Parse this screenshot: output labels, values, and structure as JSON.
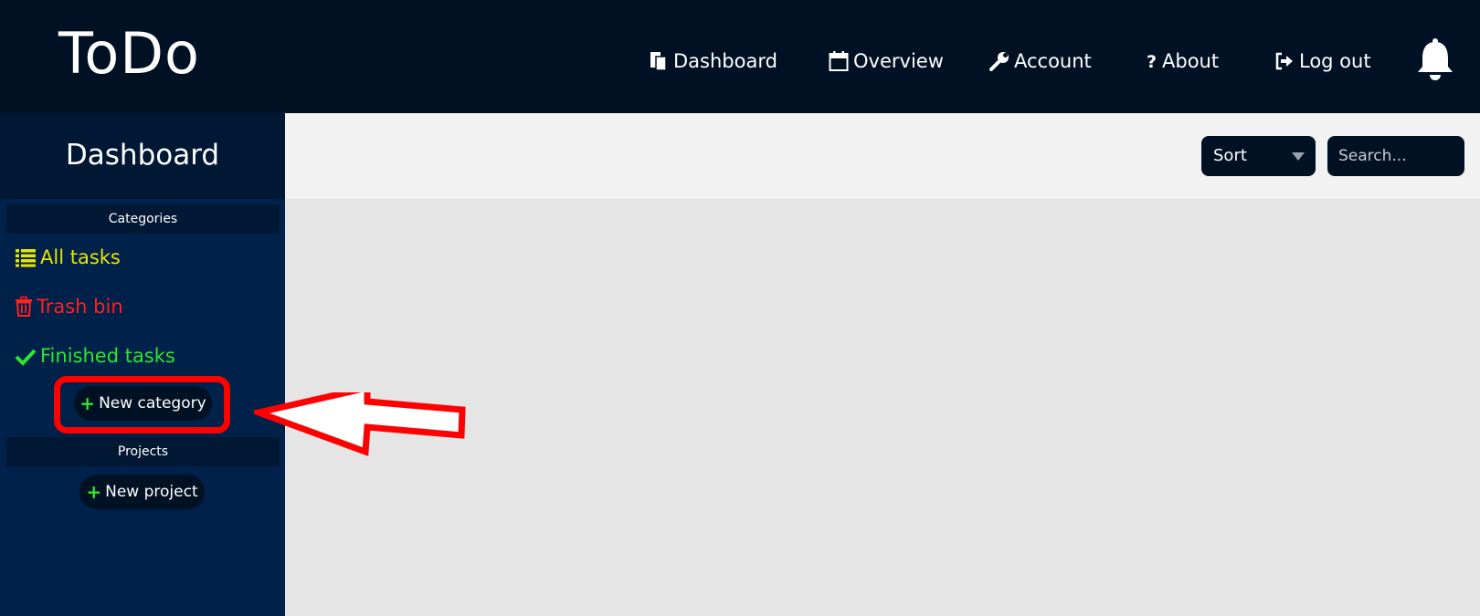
{
  "header": {
    "logo": "ToDo",
    "nav": [
      {
        "label": "Dashboard",
        "icon": "clipboard-icon"
      },
      {
        "label": "Overview",
        "icon": "calendar-icon"
      },
      {
        "label": "Account",
        "icon": "wrench-icon"
      },
      {
        "label": "About",
        "icon": "question-icon"
      },
      {
        "label": "Log out",
        "icon": "logout-icon"
      }
    ],
    "notification_icon": "bell-icon"
  },
  "sidebar": {
    "title": "Dashboard",
    "categories_heading": "Categories",
    "items": [
      {
        "label": "All tasks",
        "icon": "list-icon",
        "color": "#e6e600"
      },
      {
        "label": "Trash bin",
        "icon": "trash-icon",
        "color": "#ff2020"
      },
      {
        "label": "Finished tasks",
        "icon": "check-icon",
        "color": "#2ee52e"
      }
    ],
    "new_category_label": "New category",
    "projects_heading": "Projects",
    "new_project_label": "New project"
  },
  "toolbar": {
    "sort_label": "Sort",
    "search_placeholder": "Search..."
  },
  "colors": {
    "header_bg": "#001124",
    "sidebar_bg": "#00214a",
    "accent_plus": "#2ee52e",
    "annotation": "#ff0000"
  }
}
